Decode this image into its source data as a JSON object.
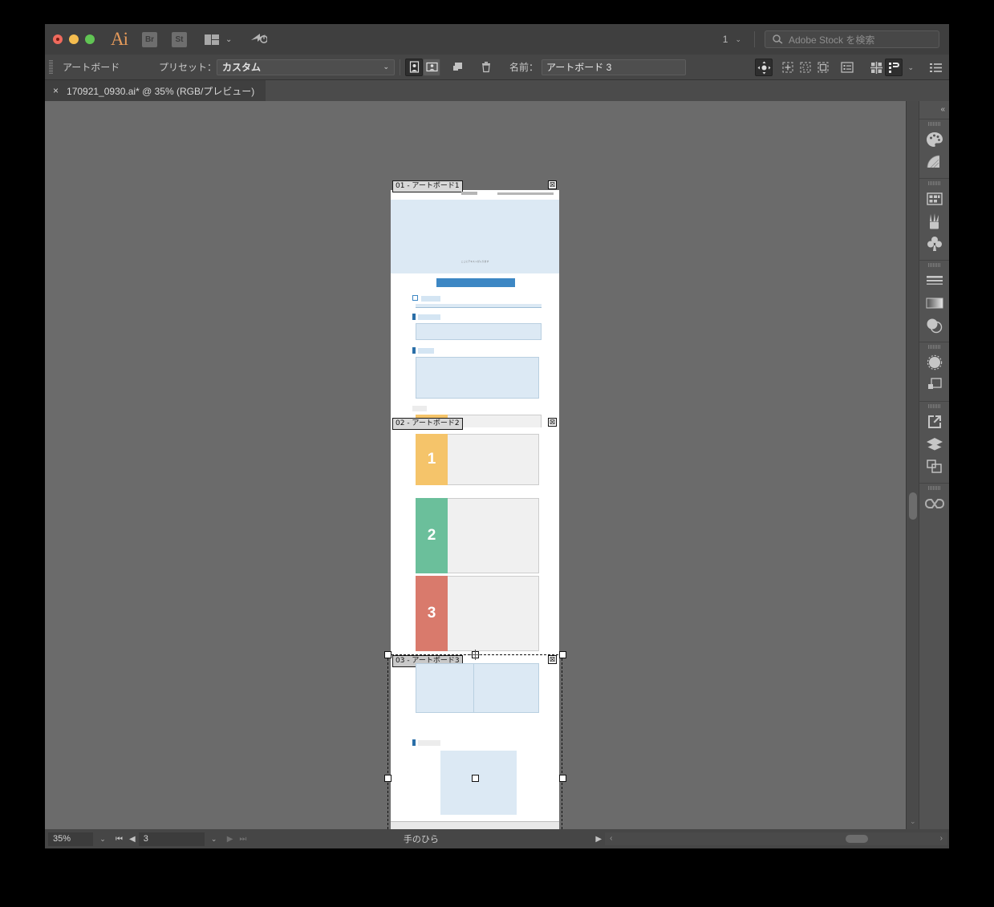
{
  "app": {
    "name": "Adobe Illustrator",
    "logo_text": "Ai",
    "bridge_label": "Br",
    "stock_label": "St"
  },
  "titlebar": {
    "page_number": "1",
    "search_placeholder": "Adobe Stock を検索",
    "caret": "⌄"
  },
  "control_bar": {
    "tool_label": "アートボード",
    "preset_label": "プリセット：",
    "preset_value": "カスタム",
    "name_label": "名前：",
    "name_value": "アートボード 3",
    "orientation_portrait": "portrait-orientation",
    "orientation_landscape": "landscape-orientation",
    "new_artboard": "new-artboard",
    "delete_artboard": "delete-artboard"
  },
  "document_tab": {
    "close": "×",
    "title": "170921_0930.ai* @ 35% (RGB/プレビュー)"
  },
  "status_bar": {
    "zoom": "35%",
    "page": "3",
    "tool_name": "手のひら"
  },
  "artboards": [
    {
      "id": "01",
      "label": "01 - アートボード1",
      "close": "⊠"
    },
    {
      "id": "02",
      "label": "02 - アートボード2",
      "close": "⊠"
    },
    {
      "id": "03",
      "label": "03 - アートボード3",
      "close": "⊠"
    }
  ],
  "artwork": {
    "hero_caption": "ここにテキストが入ります",
    "blocks": [
      {
        "number": "1",
        "color": "#f5c46a"
      },
      {
        "number": "2",
        "color": "#6bbf9b"
      },
      {
        "number": "3",
        "color": "#d97a6c"
      }
    ],
    "accent_blue": "#3d87c4",
    "panel_blue": "#1e6fb8",
    "field_fill": "#dce9f4"
  },
  "dock": {
    "collapse": "«",
    "groups": [
      {
        "icons": [
          "color-panel-icon",
          "color-guide-icon"
        ]
      },
      {
        "icons": [
          "swatches-panel-icon",
          "brushes-panel-icon",
          "symbols-panel-icon"
        ]
      },
      {
        "icons": [
          "stroke-panel-icon",
          "gradient-panel-icon",
          "transparency-panel-icon"
        ]
      },
      {
        "icons": [
          "appearance-panel-icon",
          "graphic-styles-panel-icon"
        ]
      },
      {
        "icons": [
          "asset-export-panel-icon",
          "layers-panel-icon",
          "artboards-panel-icon"
        ]
      },
      {
        "icons": [
          "creative-cloud-libraries-icon"
        ]
      }
    ]
  }
}
